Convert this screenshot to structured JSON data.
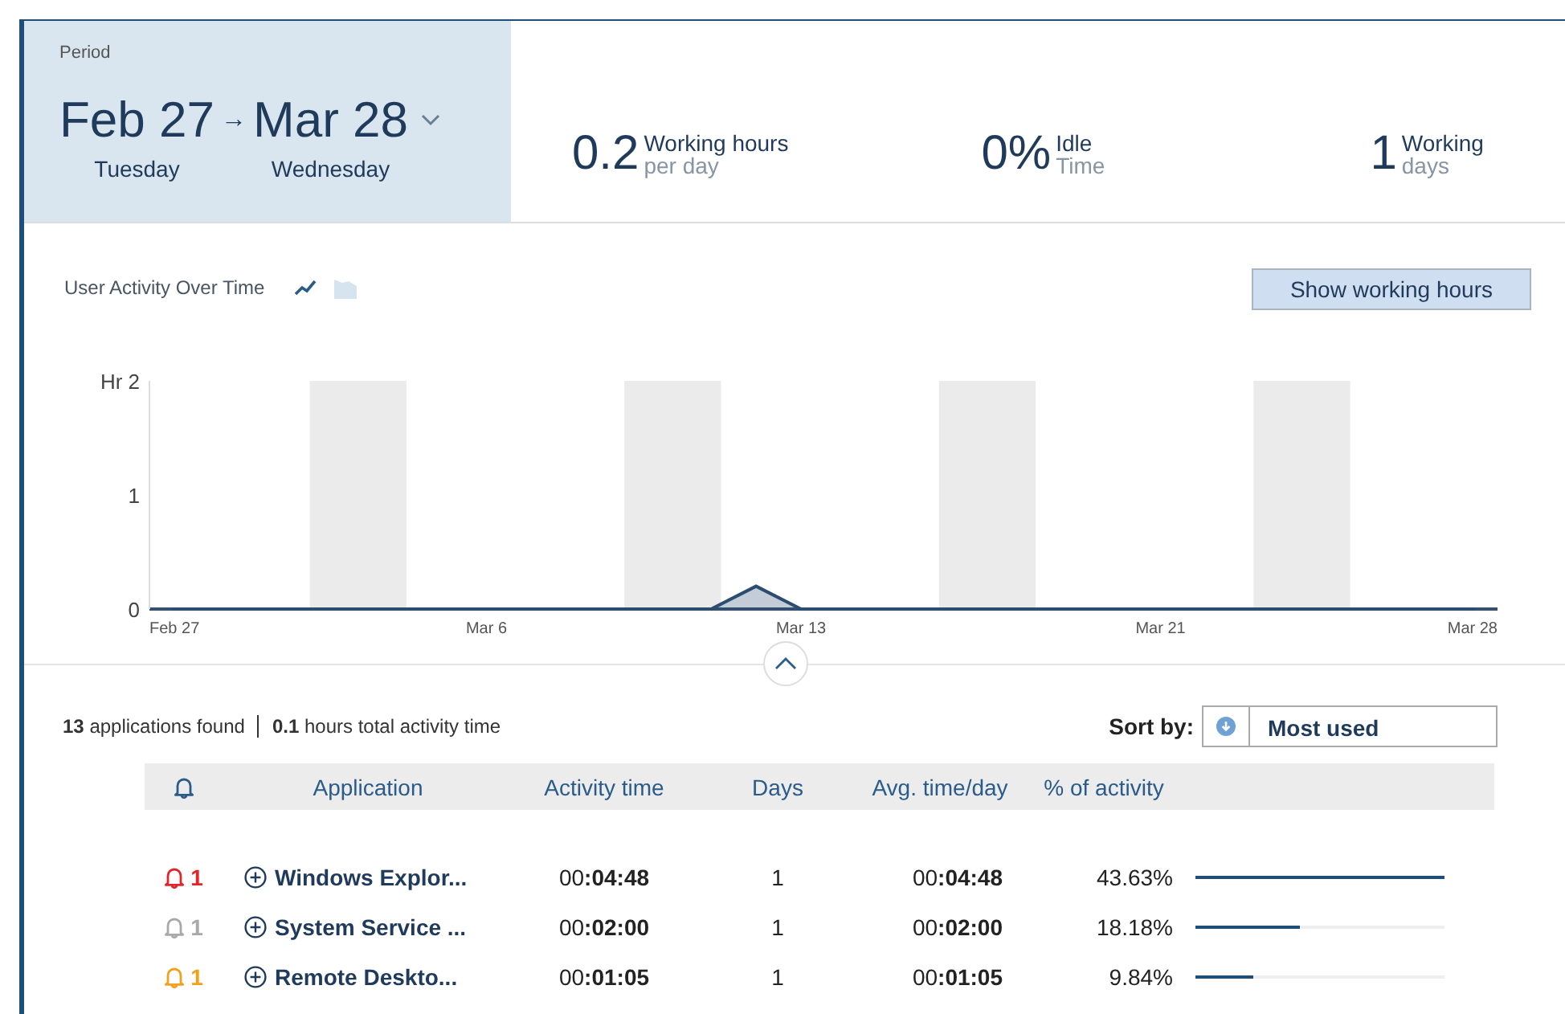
{
  "period": {
    "label": "Period",
    "start": "Feb 27",
    "arrow": "→",
    "end": "Mar 28",
    "start_day": "Tuesday",
    "end_day": "Wednesday"
  },
  "stats": [
    {
      "value": "0.2",
      "label_top": "Working hours",
      "label_bottom": "per day"
    },
    {
      "value": "0%",
      "label_top": "Idle",
      "label_bottom": "Time"
    },
    {
      "value": "1",
      "label_top": "Working",
      "label_bottom": "days"
    }
  ],
  "activity_chart": {
    "title": "User Activity Over Time",
    "view_modes": [
      {
        "kind": "line",
        "selected": true
      },
      {
        "kind": "area",
        "selected": false
      }
    ],
    "button": "Show working hours",
    "chart_data": {
      "type": "area",
      "series": [
        {
          "color": "#2b4d6f",
          "values": [
            0,
            0,
            0,
            0,
            0,
            0,
            0,
            0,
            0,
            0,
            0,
            0,
            0,
            0.2,
            0,
            0,
            0,
            0,
            0,
            0,
            0,
            0,
            0,
            0,
            0,
            0,
            0,
            0,
            0,
            0
          ]
        }
      ],
      "ylim": [
        0,
        2
      ],
      "categories": [
        "Feb 27",
        null,
        null,
        null,
        null,
        null,
        null,
        "Mar 6",
        null,
        null,
        null,
        null,
        null,
        null,
        "Mar 13",
        null,
        null,
        null,
        null,
        null,
        null,
        null,
        "Mar 21",
        null,
        null,
        null,
        null,
        null,
        null,
        "Mar 28"
      ],
      "yticks": [
        0,
        1,
        {
          "value": 2,
          "label": "Hr 2"
        }
      ]
    }
  },
  "summary": {
    "count": "13",
    "count_label": "applications found",
    "hours": "0.1",
    "hours_label": "hours total activity time"
  },
  "sort": {
    "label": "Sort by:",
    "value": "Most used"
  },
  "table": {
    "columns": [
      "Application",
      "Activity time",
      "Days",
      "Avg. time/day",
      "% of activity"
    ],
    "rows": [
      {
        "alerts": "1",
        "color": "#e0262b",
        "application": "Windows Explor...",
        "activity_time": "00**:04:48**",
        "days": "1",
        "avg_time": "00**:04:48**",
        "percent": "43.63%",
        "level": 1
      },
      {
        "alerts": "1",
        "color": "#a9a9a9",
        "application": "System Service ...",
        "activity_time": "00**:02:00**",
        "days": "1",
        "avg_time": "00**:02:00**",
        "percent": "18.18%",
        "level": 0.42
      },
      {
        "alerts": "1",
        "color": "#f0a21c",
        "application": "Remote Deskto...",
        "activity_time": "00**:01:05**",
        "days": "1",
        "avg_time": "00**:01:05**",
        "percent": "9.84%",
        "level": 0.23
      }
    ]
  }
}
